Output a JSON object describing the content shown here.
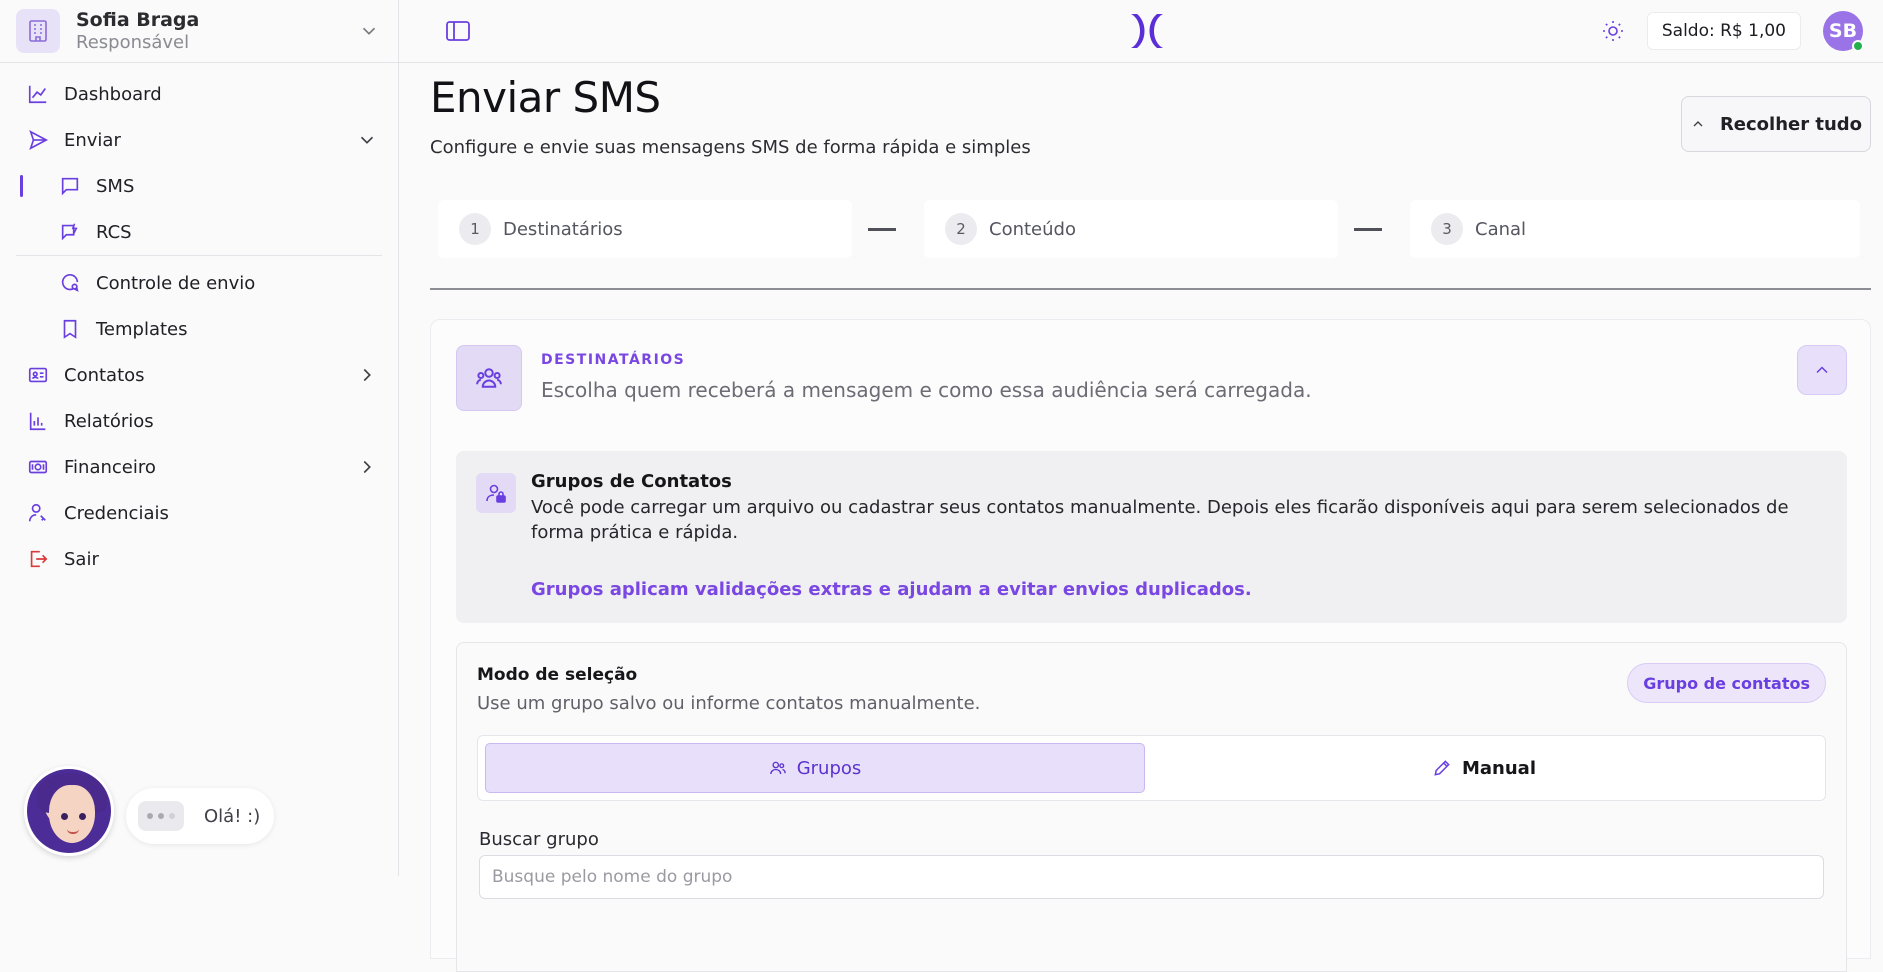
{
  "user": {
    "name": "Sofia Braga",
    "role": "Responsável"
  },
  "sidebar": {
    "items": [
      {
        "label": "Dashboard"
      },
      {
        "label": "Enviar"
      },
      {
        "label": "SMS"
      },
      {
        "label": "RCS"
      },
      {
        "label": "Controle de envio"
      },
      {
        "label": "Templates"
      },
      {
        "label": "Contatos"
      },
      {
        "label": "Relatórios"
      },
      {
        "label": "Financeiro"
      },
      {
        "label": "Credenciais"
      },
      {
        "label": "Sair"
      }
    ]
  },
  "assistant": {
    "greeting": "Olá! :)"
  },
  "topbar": {
    "balance": "Saldo: R$ 1,00",
    "avatar_initials": "SB"
  },
  "page": {
    "title": "Enviar SMS",
    "subtitle": "Configure e envie suas mensagens SMS de forma rápida e simples",
    "collapse_label": "Recolher tudo"
  },
  "steps": [
    {
      "num": "1",
      "label": "Destinatários"
    },
    {
      "num": "2",
      "label": "Conteúdo"
    },
    {
      "num": "3",
      "label": "Canal"
    }
  ],
  "card": {
    "eyebrow": "DESTINATÁRIOS",
    "description": "Escolha quem receberá a mensagem e como essa audiência será carregada."
  },
  "info": {
    "title": "Grupos de Contatos",
    "text": "Você pode carregar um arquivo ou cadastrar seus contatos manualmente. Depois eles ficarão disponíveis aqui para serem selecionados de forma prática e rápida.",
    "link": "Grupos aplicam validações extras e ajudam a evitar envios duplicados."
  },
  "mode": {
    "title": "Modo de seleção",
    "subtitle": "Use um grupo salvo ou informe contatos manualmente.",
    "badge": "Grupo de contatos",
    "option_groups": "Grupos",
    "option_manual": "Manual",
    "search_label": "Buscar grupo",
    "search_placeholder": "Busque pelo nome do grupo"
  },
  "colors": {
    "accent": "#6a3fe0",
    "accent_soft": "#e8e0fa",
    "online": "#22b14c"
  }
}
